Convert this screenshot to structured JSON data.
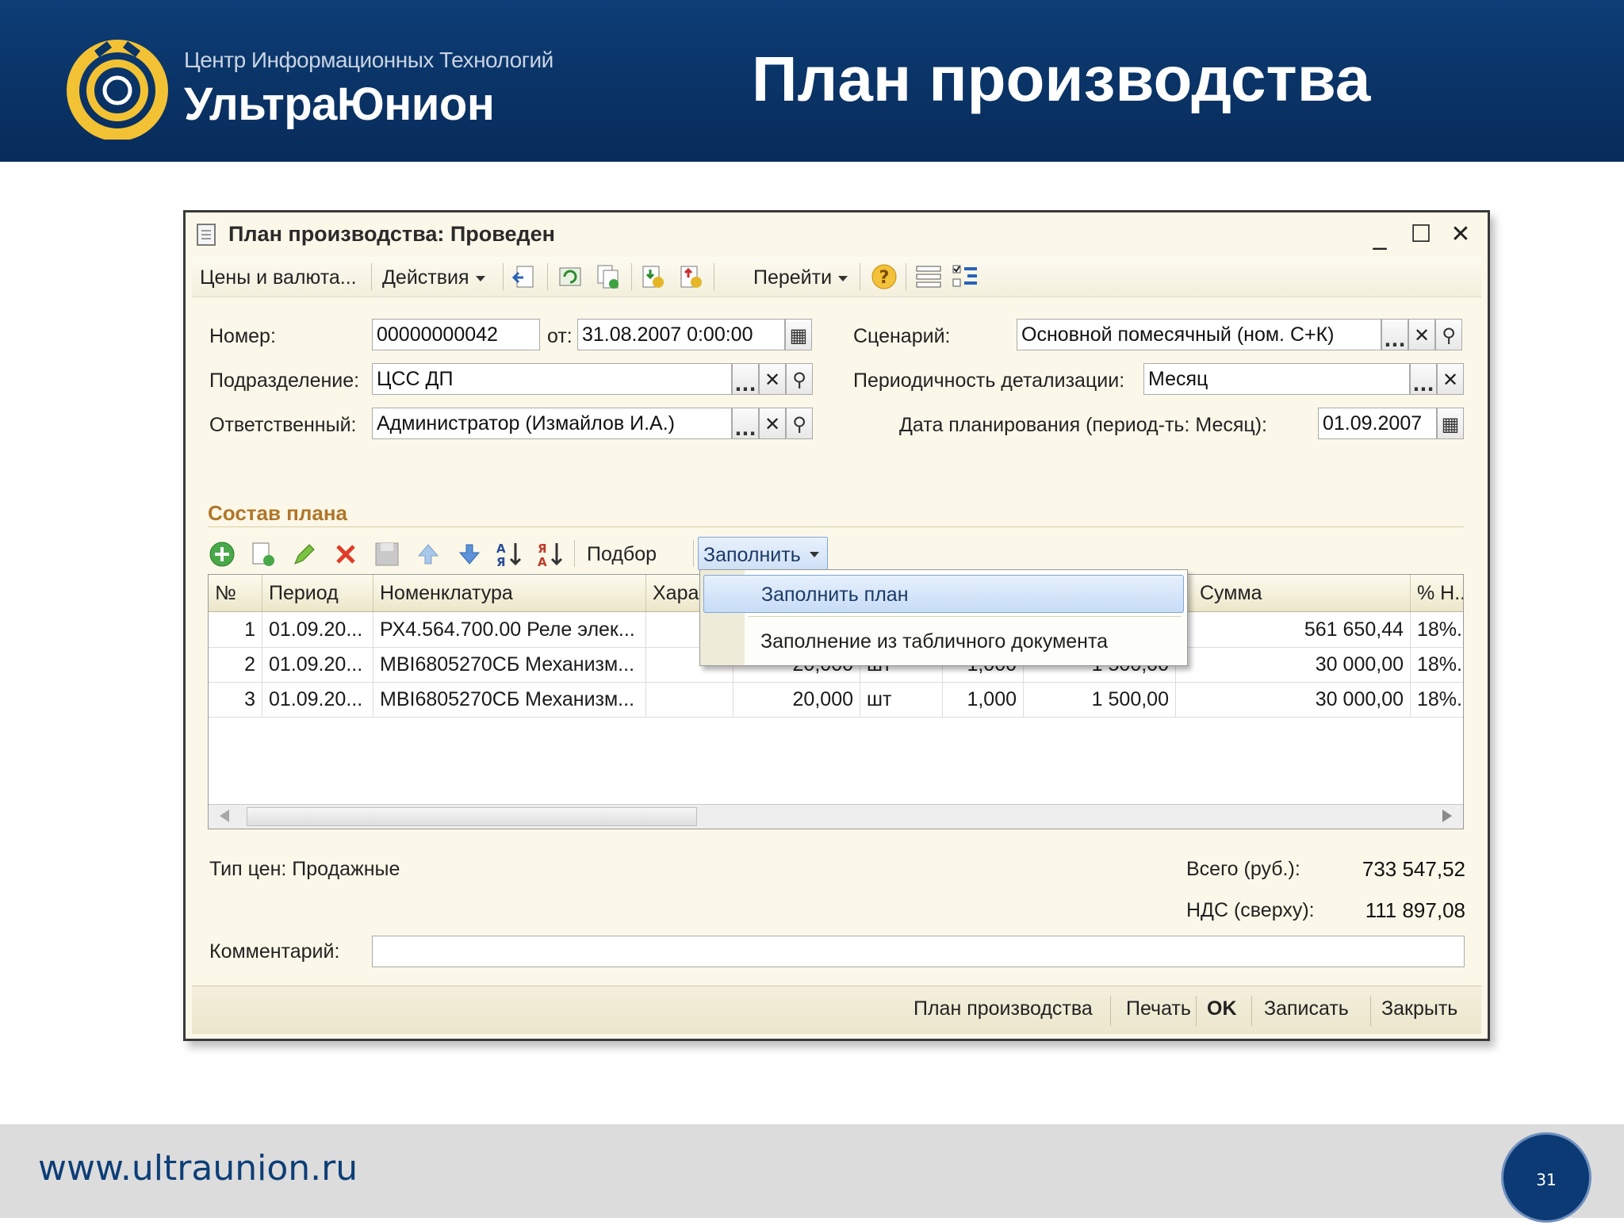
{
  "slide": {
    "company_line1": "Центр Информационных Технологий",
    "company_line2": "УльтраЮнион",
    "title": "План производства",
    "footer_url": "www.ultraunion.ru",
    "page_number": "31"
  },
  "window": {
    "title": "План производства: Проведен",
    "controls": {
      "minimize": "_",
      "maximize": "☐",
      "close": "✕"
    }
  },
  "toolbar": {
    "prices": "Цены и валюта...",
    "actions": "Действия",
    "goto": "Перейти",
    "icons": [
      "post-icon",
      "refresh-icon",
      "copy-icon",
      "fill-from-icon",
      "fill-to-icon",
      "help-icon",
      "structure-icon",
      "subordinate-icon"
    ]
  },
  "header": {
    "number_label": "Номер:",
    "number_value": "00000000042",
    "from_label": "от:",
    "date_value": "31.08.2007  0:00:00",
    "scenario_label": "Сценарий:",
    "scenario_value": "Основной помесячный (ном. С+К)",
    "division_label": "Подразделение:",
    "division_value": "ЦСС ДП",
    "periodicity_label": "Периодичность детализации:",
    "periodicity_value": "Месяц",
    "responsible_label": "Ответственный:",
    "responsible_value": "Администратор (Измайлов И.А.)",
    "plan_date_label": "Дата планирования (период-ть: Месяц):",
    "plan_date_value": "01.09.2007"
  },
  "section": {
    "title": "Состав плана",
    "selection": "Подбор",
    "fill": "Заполнить"
  },
  "table": {
    "columns": [
      "№",
      "Период",
      "Номенклатура",
      "Хара",
      "",
      "",
      "",
      "",
      "Сумма",
      "% Н.."
    ],
    "rows": [
      {
        "n": "1",
        "period": "01.09.20...",
        "item": "РХ4.564.700.00 Реле элек...",
        "qty": "",
        "unit": "",
        "coef": "",
        "price": "",
        "sum": "561 650,44",
        "vat": "18%.."
      },
      {
        "n": "2",
        "period": "01.09.20...",
        "item": "МВI6805270СБ Механизм...",
        "qty": "20,000",
        "unit": "шт",
        "coef": "1,000",
        "price": "1 500,00",
        "sum": "30 000,00",
        "vat": "18%.."
      },
      {
        "n": "3",
        "period": "01.09.20...",
        "item": "МВI6805270СБ Механизм...",
        "qty": "20,000",
        "unit": "шт",
        "coef": "1,000",
        "price": "1 500,00",
        "sum": "30 000,00",
        "vat": "18%.."
      }
    ]
  },
  "dropdown": {
    "items": [
      "Заполнить план",
      "Заполнение из табличного документа"
    ]
  },
  "footer_info": {
    "price_type": "Тип цен: Продажные",
    "total_label": "Всего (руб.):",
    "total_value": "733 547,52",
    "vat_label": "НДС (сверху):",
    "vat_value": "111 897,08",
    "comment_label": "Комментарий:",
    "comment_value": ""
  },
  "bottom_buttons": {
    "plan": "План производства",
    "print": "Печать",
    "ok": "OK",
    "save": "Записать",
    "close": "Закрыть"
  },
  "colors": {
    "header_blue": "#0b3a74",
    "section_title": "#b0762a",
    "window_bg": "#fbf8e9",
    "highlight": "#c7dcf6"
  }
}
